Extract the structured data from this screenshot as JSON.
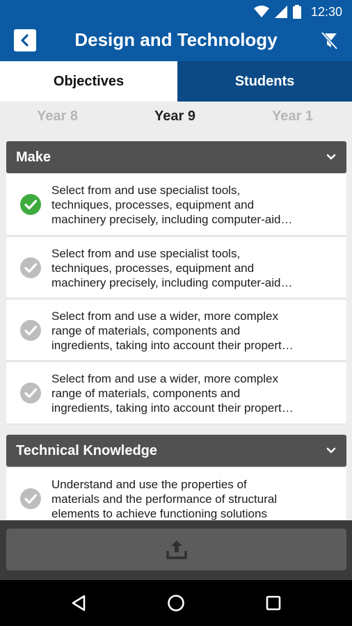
{
  "status_bar": {
    "time": "12:30",
    "icons": [
      "wifi-icon",
      "cell-signal-icon",
      "battery-icon"
    ]
  },
  "app_bar": {
    "title": "Design and Technology",
    "back_icon": "chevron-left-icon",
    "filter_icon": "filter-off-icon"
  },
  "tabs": [
    {
      "label": "Objectives",
      "selected": true
    },
    {
      "label": "Students",
      "selected": false
    }
  ],
  "years": {
    "previous": "Year 8",
    "current": "Year 9",
    "next": "Year 1"
  },
  "sections": [
    {
      "title": "Make",
      "items": [
        {
          "status": "complete",
          "lines": [
            "Select from and use specialist tools,",
            "techniques, processes, equipment and",
            "machinery precisely, including computer-aid…"
          ]
        },
        {
          "status": "incomplete",
          "lines": [
            "Select from and use specialist tools,",
            "techniques, processes, equipment and",
            "machinery precisely, including computer-aid…"
          ]
        },
        {
          "status": "incomplete",
          "lines": [
            "Select from and use a wider, more complex",
            "range of materials, components and",
            "ingredients, taking into account their propert…"
          ]
        },
        {
          "status": "incomplete",
          "lines": [
            "Select from and use a wider, more complex",
            "range of materials, components and",
            "ingredients, taking into account their propert…"
          ]
        }
      ]
    },
    {
      "title": "Technical Knowledge",
      "items": [
        {
          "status": "incomplete",
          "lines": [
            "Understand and use the properties of",
            "materials and the performance of structural",
            "elements to achieve functioning solutions"
          ]
        }
      ]
    }
  ],
  "colors": {
    "primary": "#0b5aa3",
    "tab_active_dark": "#0c4a86",
    "section_header": "#515151",
    "check_complete": "#3dab3d",
    "check_incomplete": "#bdbdbd"
  },
  "action_bar": {
    "upload_icon": "upload-icon"
  },
  "nav_bar": {
    "icons": [
      "back-triangle-icon",
      "home-circle-icon",
      "recents-square-icon"
    ]
  }
}
